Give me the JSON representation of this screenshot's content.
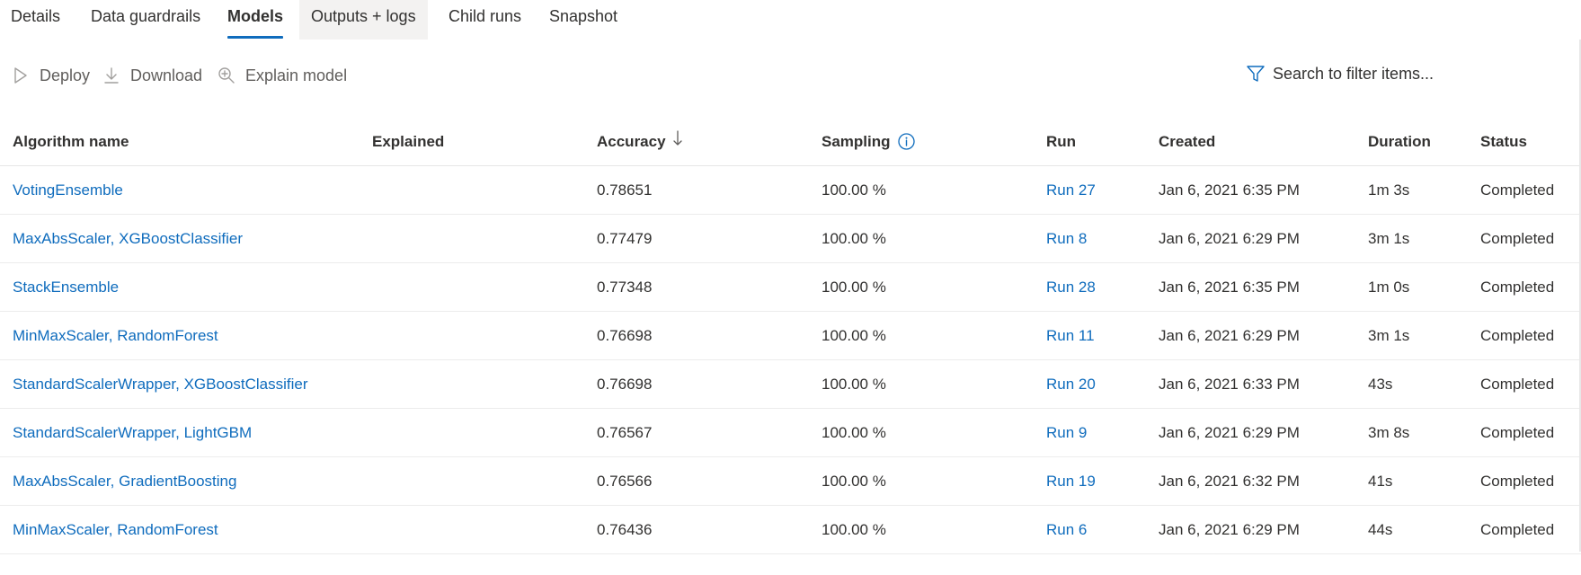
{
  "tabs": [
    {
      "label": "Details"
    },
    {
      "label": "Data guardrails"
    },
    {
      "label": "Models"
    },
    {
      "label": "Outputs + logs"
    },
    {
      "label": "Child runs"
    },
    {
      "label": "Snapshot"
    }
  ],
  "active_tab": "Models",
  "toolbar": {
    "deploy_label": "Deploy",
    "download_label": "Download",
    "explain_label": "Explain model",
    "search_placeholder": "Search to filter items..."
  },
  "columns": {
    "algorithm": "Algorithm name",
    "explained": "Explained",
    "accuracy": "Accuracy",
    "sampling": "Sampling",
    "run": "Run",
    "created": "Created",
    "duration": "Duration",
    "status": "Status"
  },
  "icons": {
    "deploy": "play-outline-icon",
    "download": "download-arrow-icon",
    "explain": "magnifier-plus-icon",
    "filter": "funnel-icon",
    "sort": "arrow-down-icon",
    "info": "info-circle-icon"
  },
  "colors": {
    "accent": "#0f6cbd",
    "text": "#323130",
    "muted": "#605e5c"
  },
  "rows": [
    {
      "algorithm": "VotingEnsemble",
      "explained": "",
      "accuracy": "0.78651",
      "sampling": "100.00 %",
      "run": "Run 27",
      "created": "Jan 6, 2021 6:35 PM",
      "duration": "1m 3s",
      "status": "Completed"
    },
    {
      "algorithm": "MaxAbsScaler, XGBoostClassifier",
      "explained": "",
      "accuracy": "0.77479",
      "sampling": "100.00 %",
      "run": "Run 8",
      "created": "Jan 6, 2021 6:29 PM",
      "duration": "3m 1s",
      "status": "Completed"
    },
    {
      "algorithm": "StackEnsemble",
      "explained": "",
      "accuracy": "0.77348",
      "sampling": "100.00 %",
      "run": "Run 28",
      "created": "Jan 6, 2021 6:35 PM",
      "duration": "1m 0s",
      "status": "Completed"
    },
    {
      "algorithm": "MinMaxScaler, RandomForest",
      "explained": "",
      "accuracy": "0.76698",
      "sampling": "100.00 %",
      "run": "Run 11",
      "created": "Jan 6, 2021 6:29 PM",
      "duration": "3m 1s",
      "status": "Completed"
    },
    {
      "algorithm": "StandardScalerWrapper, XGBoostClassifier",
      "explained": "",
      "accuracy": "0.76698",
      "sampling": "100.00 %",
      "run": "Run 20",
      "created": "Jan 6, 2021 6:33 PM",
      "duration": "43s",
      "status": "Completed"
    },
    {
      "algorithm": "StandardScalerWrapper, LightGBM",
      "explained": "",
      "accuracy": "0.76567",
      "sampling": "100.00 %",
      "run": "Run 9",
      "created": "Jan 6, 2021 6:29 PM",
      "duration": "3m 8s",
      "status": "Completed"
    },
    {
      "algorithm": "MaxAbsScaler, GradientBoosting",
      "explained": "",
      "accuracy": "0.76566",
      "sampling": "100.00 %",
      "run": "Run 19",
      "created": "Jan 6, 2021 6:32 PM",
      "duration": "41s",
      "status": "Completed"
    },
    {
      "algorithm": "MinMaxScaler, RandomForest",
      "explained": "",
      "accuracy": "0.76436",
      "sampling": "100.00 %",
      "run": "Run 6",
      "created": "Jan 6, 2021 6:29 PM",
      "duration": "44s",
      "status": "Completed"
    }
  ]
}
